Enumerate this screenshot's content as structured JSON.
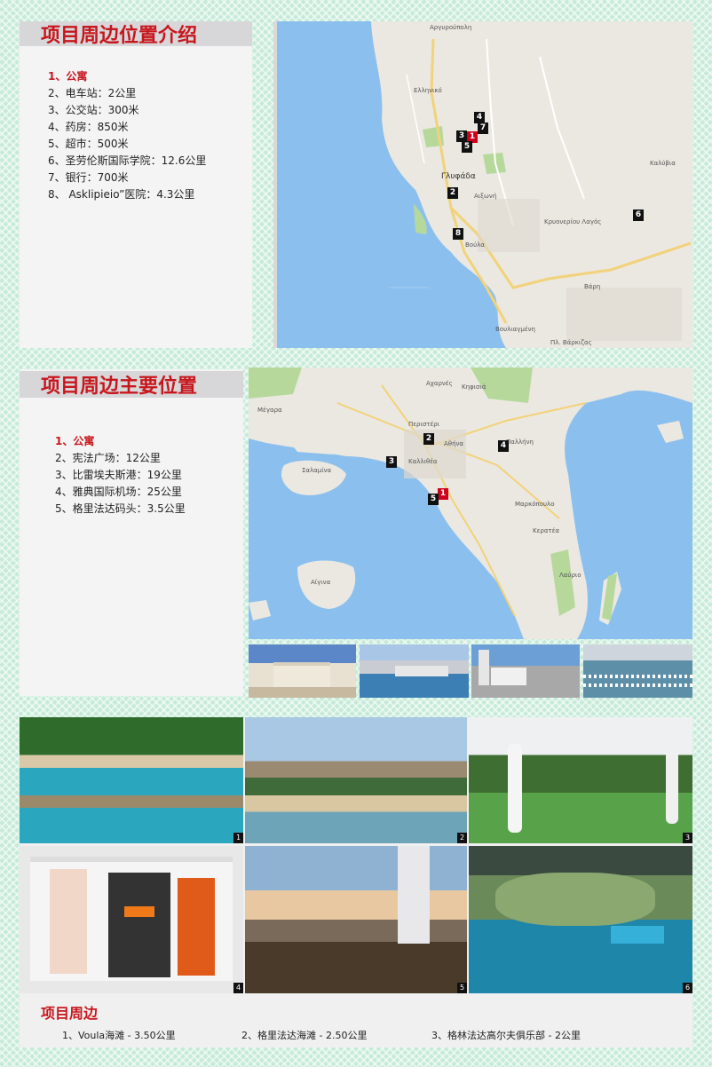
{
  "section1": {
    "title": "项目周边位置介绍",
    "items": [
      "1、公寓",
      "2、电车站：2公里",
      "3、公交站：300米",
      "4、药房：850米",
      "5、超市：500米",
      "6、圣劳伦斯国际学院：12.6公里",
      "7、银行：700米",
      "8、 Asklipieio”医院：4.3公里"
    ],
    "map_labels": [
      "Αργυρούπολη",
      "Ελληνικό",
      "Γλυφάδα",
      "Αιξωνή",
      "Βούλα",
      "Κρυονερίου Λαγός",
      "Βάρη",
      "Βουλιαγμένη",
      "Πλ. Βάρκιζας",
      "Καλύβια"
    ],
    "markers": [
      "1",
      "2",
      "3",
      "4",
      "5",
      "6",
      "7",
      "8"
    ]
  },
  "section2": {
    "title": "项目周边主要位置",
    "items": [
      "1、公寓",
      "2、宪法广场：12公里",
      "3、比雷埃夫斯港：19公里",
      "4、雅典国际机场：25公里",
      "5、格里法达码头：3.5公里"
    ],
    "map_labels": [
      "Αχαρνές",
      "Περιστέρι",
      "Αθήνα",
      "Καλλιθέα",
      "Κηφισιά",
      "Παλλήνη",
      "Μέγαρα",
      "Σαλαμίνα",
      "Αίγινα",
      "Λαύριο",
      "Μαρκόπουλο",
      "Κερατέα"
    ],
    "markers": [
      "1",
      "2",
      "3",
      "4",
      "5"
    ]
  },
  "photos": [
    "1",
    "2",
    "3",
    "4",
    "5",
    "6"
  ],
  "section3": {
    "title": "项目周边",
    "items": [
      "1、Voula海滩 - 3.50公里",
      "2、格里法达海滩 - 2.50公里",
      "3、格林法达高尔夫俱乐部 - 2公里"
    ]
  },
  "colors": {
    "accent": "#c8161d",
    "sea": "#8bc0ee",
    "land": "#ebe8e1",
    "park": "#b6d99b",
    "road": "#f2d27a"
  }
}
